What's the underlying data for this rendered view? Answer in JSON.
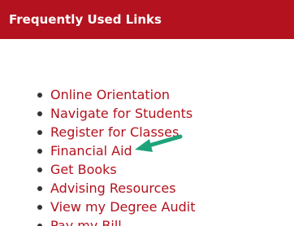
{
  "panel": {
    "title": "Frequently Used Links",
    "header_color": "#b3121e",
    "link_color": "#b3121e"
  },
  "links": [
    {
      "label": "Online Orientation"
    },
    {
      "label": "Navigate for Students"
    },
    {
      "label": "Register for Classes"
    },
    {
      "label": "Financial Aid"
    },
    {
      "label": "Get Books"
    },
    {
      "label": "Advising Resources"
    },
    {
      "label": "View my Degree Audit"
    },
    {
      "label": "Pay my Bill"
    }
  ],
  "annotation": {
    "icon": "arrow-pointer-icon",
    "color": "#1fa37a"
  }
}
